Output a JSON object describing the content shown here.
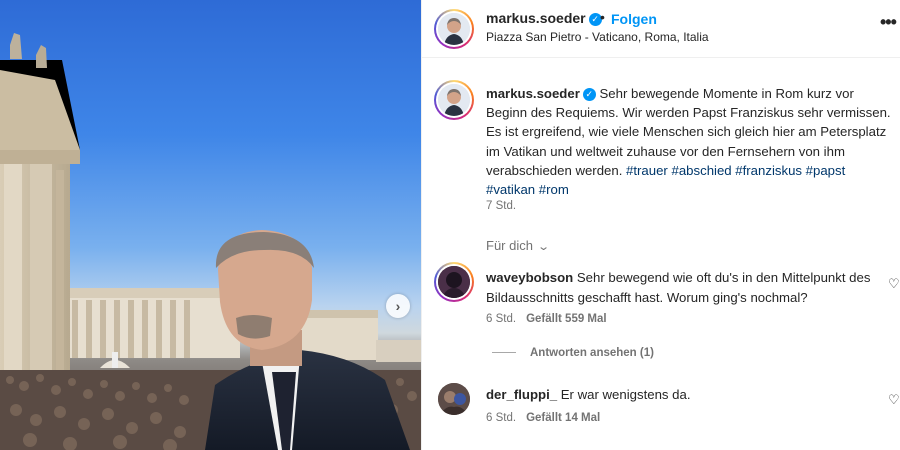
{
  "post": {
    "username": "markus.soeder",
    "verified": true,
    "follow_label": "Folgen",
    "separator": "•",
    "location": "Piazza San Pietro - Vatican​o, Roma, Italia",
    "more_icon": "more-options-icon"
  },
  "caption": {
    "username": "markus.soeder",
    "text": "Sehr bewegende Momente in Rom kurz vor Beginn des Requiems. Wir werden Papst Franziskus sehr vermissen. Es ist ergreifend, wie viele Menschen sich gleich hier am Petersplatz im Vatikan und weltweit zuhause vor den Fernsehern von ihm verabschieden werden.",
    "hashtags": [
      "#trauer",
      "#abschied",
      "#franziskus",
      "#papst",
      "#vatikan",
      "#rom"
    ],
    "time": "7 Std."
  },
  "sort": {
    "label": "Für dich"
  },
  "comments": [
    {
      "username": "waveybobson",
      "text": "Sehr bewegend wie oft du's in den Mittelpunkt des Bildausschnitts geschafft hast. Worum ging's nochmal?",
      "time": "6 Std.",
      "likes": "Gefällt 559 Mal",
      "replies": "Antworten ansehen (1)"
    },
    {
      "username": "der_fluppi_",
      "text": "Er war wenigstens da.",
      "time": "6 Std.",
      "likes": "Gefällt 14 Mal"
    }
  ],
  "colors": {
    "accent": "#0095f6",
    "hashtag": "#00376b",
    "muted": "#737373",
    "text": "#262626"
  }
}
